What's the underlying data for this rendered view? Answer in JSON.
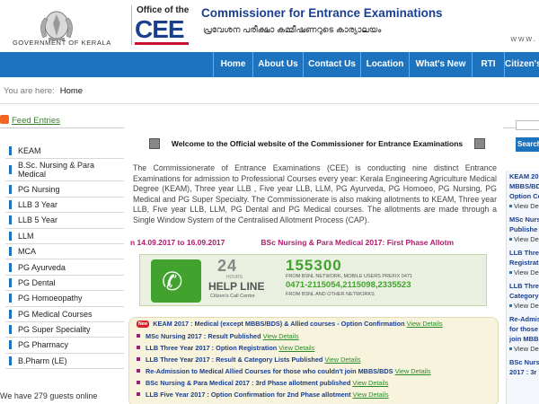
{
  "header": {
    "gov_text": "GOVERNMENT OF KERALA",
    "office_of": "Office of the",
    "logo": "CEE",
    "title_en": "Commissioner for Entrance Examinations",
    "title_ml": "പ്രവേശന പരീക്ഷാ കമ്മീഷണറുടെ കാര്യാലയം",
    "www": "www."
  },
  "nav": {
    "items": [
      {
        "label": "Home",
        "w": 44
      },
      {
        "label": "About Us",
        "w": 56
      },
      {
        "label": "Contact Us",
        "w": 64
      },
      {
        "label": "Location",
        "w": 54
      },
      {
        "label": "What's New",
        "w": 70
      },
      {
        "label": "RTI",
        "w": 36
      },
      {
        "label": "Citizen's",
        "w": 39
      }
    ],
    "color": "#1e73be"
  },
  "breadcrumb": {
    "prefix": "You are here:",
    "current": "Home"
  },
  "sidebar": {
    "feed_label": "Feed Entries",
    "items": [
      "KEAM",
      "B.Sc. Nursing & Para Medical",
      "PG Nursing",
      "LLB 3 Year",
      "LLB 5 Year",
      "LLM",
      "MCA",
      "PG Ayurveda",
      "PG Dental",
      "PG Homoeopathy",
      "PG Medical Courses",
      "PG Super Speciality",
      "PG Pharmacy",
      "B.Pharm (LE)"
    ],
    "guests": "We have 279 guests online"
  },
  "main": {
    "welcome": "Welcome to the Official website of the Commissioner for Entrance Examinations",
    "paragraph": "The Commissionerate of Entrance Examinations (CEE) is conducting nine distinct Entrance Examinations for admission to Professional Courses every year: Kerala Engineering Agriculture Medical Degree (KEAM), Three year LLB , Five year LLB, LLM, PG Ayurveda, PG Homoeo, PG Nursing, PG Medical and PG Super Specialty. The Commissionerate is also making allotments to KEAM, Three year LLB, Five year LLB, LLM, PG Dental and PG Medical courses. The allotments are made through a Single Window System of the Centralised Allotment Process (CAP).",
    "ticker": [
      "n 14.09.2017 to 16.09.2017",
      "BSc Nursing & Para Medical 2017: First Phase Allotm"
    ],
    "helpline": {
      "big": "24",
      "hours": "HOURS",
      "label": "HELP LINE",
      "sub": "Citizen's Call Centre",
      "num1": "155300",
      "note1": "FROM BSNL NETWORK, MOBILE USERS PREFIX 0471",
      "num2": "0471-2115054,2115098,2335523",
      "note2": "FROM BSNL AND OTHER NETWORKS"
    },
    "news": [
      {
        "text": "KEAM 2017 : Medical (except MBBS/BDS) & Allied courses - Option Confirmation",
        "link": "View Details",
        "badge": "New"
      },
      {
        "text": "MSc Nursing 2017 : Result Published",
        "link": "View Details"
      },
      {
        "text": "LLB Three Year 2017 : Option Registration",
        "link": "View Details"
      },
      {
        "text": "LLB Three Year 2017 : Result & Category Lists Published",
        "link": "View Details"
      },
      {
        "text": "Re-Admission to Medical Allied Courses for those who couldn't join MBBS/BDS",
        "link": "View Details"
      },
      {
        "text": "BSc Nursing & Para Medical 2017 : 3rd Phase allotment published",
        "link": "View Details"
      },
      {
        "text": "LLB Five Year 2017 : Option Confirmation for 2nd Phase allotment",
        "link": "View Details"
      }
    ]
  },
  "right": {
    "search_label": "Search",
    "panel": [
      {
        "kind": "title",
        "text": "KEAM 20"
      },
      {
        "kind": "title",
        "text": "MBBS/BD"
      },
      {
        "kind": "title",
        "text": "Option Co"
      },
      {
        "kind": "view",
        "text": "View De"
      },
      {
        "kind": "title",
        "text": "MSc Nurs"
      },
      {
        "kind": "title",
        "text": "Publishe"
      },
      {
        "kind": "view",
        "text": "View De"
      },
      {
        "kind": "title",
        "text": "LLB Three"
      },
      {
        "kind": "title",
        "text": "Registrat"
      },
      {
        "kind": "view",
        "text": "View De"
      },
      {
        "kind": "title",
        "text": "LLB Three"
      },
      {
        "kind": "title",
        "text": "Category"
      },
      {
        "kind": "view",
        "text": "View De"
      },
      {
        "kind": "title",
        "text": "Re-Admis"
      },
      {
        "kind": "title",
        "text": "for those"
      },
      {
        "kind": "title",
        "text": "join MBB"
      },
      {
        "kind": "view",
        "text": "View De"
      },
      {
        "kind": "title",
        "text": "BSc Nurs"
      },
      {
        "kind": "title",
        "text": "2017 : 3r"
      }
    ]
  }
}
